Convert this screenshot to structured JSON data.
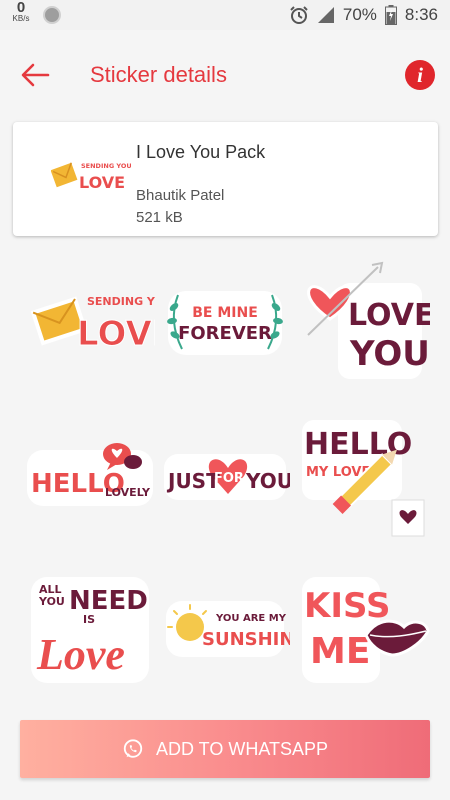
{
  "status_bar": {
    "speed_value": "0",
    "speed_unit": "KB/s",
    "battery_percent": "70%",
    "time": "8:36",
    "icons": [
      "alarm-icon",
      "signal-icon",
      "battery-icon"
    ]
  },
  "app_bar": {
    "title": "Sticker details",
    "back_icon": "arrow-left-icon",
    "info_label": "i",
    "accent_color": "#e5393f"
  },
  "pack": {
    "name": "I Love You Pack",
    "author": "Bhautik Patel",
    "size": "521 kB"
  },
  "stickers": [
    {
      "name": "sending-you-love",
      "top": "SENDING YOU",
      "main": "LOVE"
    },
    {
      "name": "be-mine-forever",
      "top": "BE MINE",
      "main": "FOREVER"
    },
    {
      "name": "love-you",
      "top": "LOVE",
      "main": "YOU"
    },
    {
      "name": "hello-lovely",
      "top": "HELLO",
      "main": "LOVELY"
    },
    {
      "name": "just-for-you",
      "top": "JUST",
      "mid": "FOR",
      "main": "YOU"
    },
    {
      "name": "hello-my-love",
      "top": "HELLO",
      "main": "MY LOVE"
    },
    {
      "name": "all-you-need-is-love",
      "top1": "ALL",
      "top2": "YOU",
      "top3": "NEED",
      "mid": "IS",
      "main": "Love"
    },
    {
      "name": "you-are-my-sunshine",
      "top": "YOU ARE MY",
      "main": "SUNSHINE"
    },
    {
      "name": "kiss-me",
      "top": "KISS",
      "main": "ME"
    }
  ],
  "add_button": {
    "label": "ADD TO WHATSAPP",
    "icon": "whatsapp-icon"
  }
}
